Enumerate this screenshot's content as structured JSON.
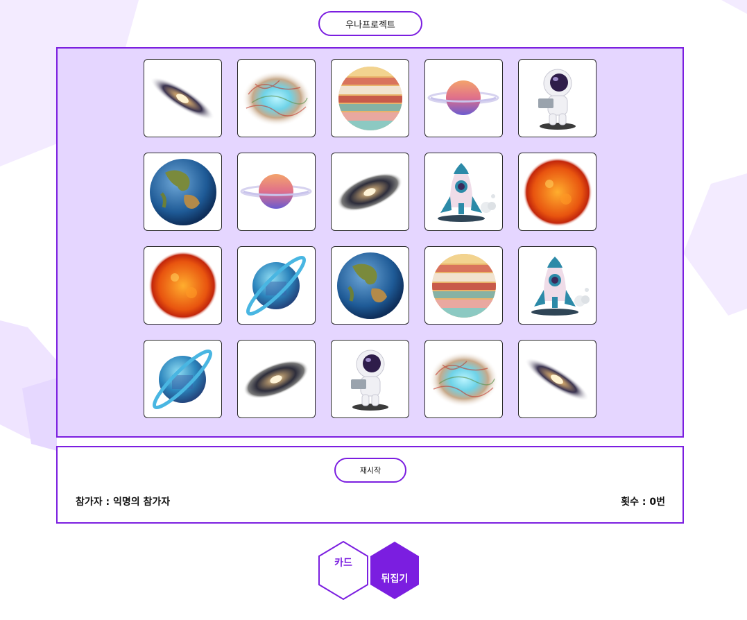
{
  "header": {
    "title": "우나프로젝트"
  },
  "colors": {
    "accent": "#7b1ee0",
    "board_bg": "#e5d6ff"
  },
  "board": {
    "cards": [
      {
        "icon": "galaxy-icon"
      },
      {
        "icon": "nebula-icon"
      },
      {
        "icon": "jupiter-icon"
      },
      {
        "icon": "ringed-planet-icon"
      },
      {
        "icon": "astronaut-icon"
      },
      {
        "icon": "earth-icon"
      },
      {
        "icon": "ringed-planet-icon"
      },
      {
        "icon": "galaxy-dark-icon"
      },
      {
        "icon": "rocket-icon"
      },
      {
        "icon": "sun-icon"
      },
      {
        "icon": "sun-icon"
      },
      {
        "icon": "blue-ringed-planet-icon"
      },
      {
        "icon": "earth-icon"
      },
      {
        "icon": "jupiter-icon"
      },
      {
        "icon": "rocket-icon"
      },
      {
        "icon": "blue-ringed-planet-icon"
      },
      {
        "icon": "galaxy-dark-icon"
      },
      {
        "icon": "astronaut-icon"
      },
      {
        "icon": "nebula-icon"
      },
      {
        "icon": "galaxy-icon"
      }
    ]
  },
  "info": {
    "restart_label": "재시작",
    "participant_label": "참가자 : ",
    "participant_name": "익명의 참가자",
    "count_label": "횟수 : ",
    "count_value": "0번"
  },
  "bottom": {
    "card_label": "카드",
    "flip_label": "뒤집기"
  }
}
